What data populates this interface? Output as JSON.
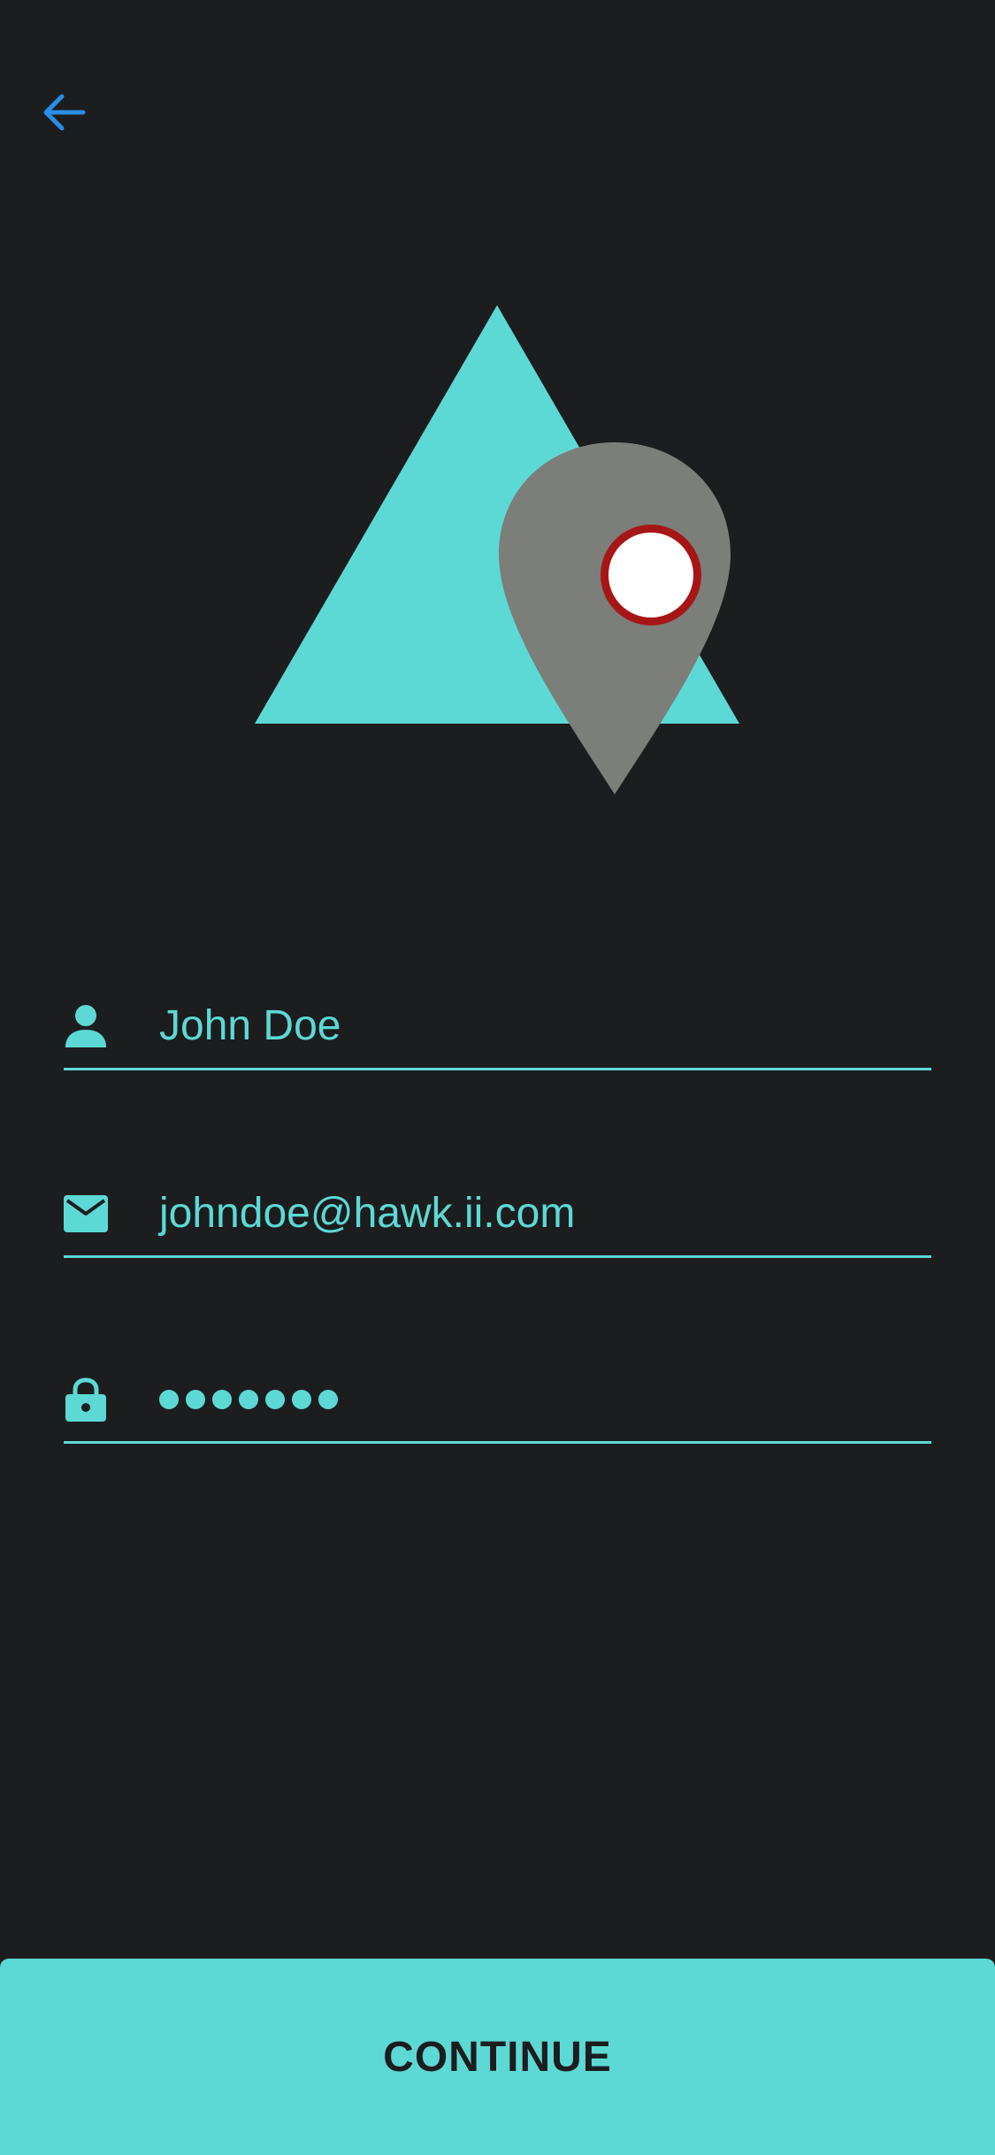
{
  "colors": {
    "background": "#1c1d1f",
    "accent": "#5cd9d5",
    "back_arrow": "#2a8de8",
    "pin": "#7b7e79",
    "pin_ring": "#a71616",
    "pin_center": "#ffffff"
  },
  "header": {
    "back_icon": "arrow-left-icon"
  },
  "logo": {
    "icon": "triangle-location-pin-logo"
  },
  "form": {
    "name": {
      "icon": "person-icon",
      "value": "John Doe"
    },
    "email": {
      "icon": "mail-icon",
      "value": "johndoe@hawk.ii.com"
    },
    "password": {
      "icon": "lock-icon",
      "masked_length": 7
    }
  },
  "footer": {
    "continue_label": "CONTINUE"
  }
}
